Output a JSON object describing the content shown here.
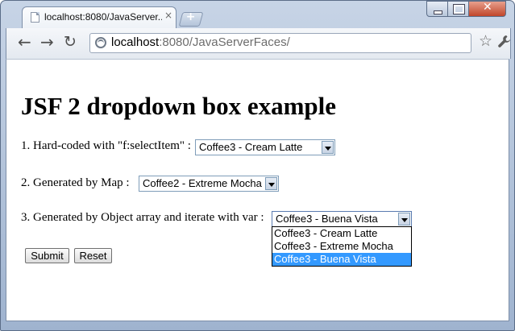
{
  "browser": {
    "tab_title": "localhost:8080/JavaServer...",
    "tab_close": "×",
    "new_tab": "+",
    "url_host": "localhost",
    "url_rest": ":8080/JavaServerFaces/"
  },
  "page": {
    "heading": "JSF 2 dropdown box example",
    "rows": [
      {
        "label": "1. Hard-coded with \"f:selectItem\" :",
        "selected": "Coffee3 - Cream Latte"
      },
      {
        "label": "2. Generated by Map :",
        "selected": "Coffee2 - Extreme Mocha"
      },
      {
        "label": "3. Generated by Object array and iterate with var :",
        "selected": "Coffee3 - Buena Vista"
      }
    ],
    "dropdown_options": [
      "Coffee3 - Cream Latte",
      "Coffee3 - Extreme Mocha",
      "Coffee3 - Buena Vista"
    ],
    "dropdown_selected_index": 2,
    "submit_label": "Submit",
    "reset_label": "Reset"
  },
  "colors": {
    "selection_highlight": "#3399ff"
  }
}
